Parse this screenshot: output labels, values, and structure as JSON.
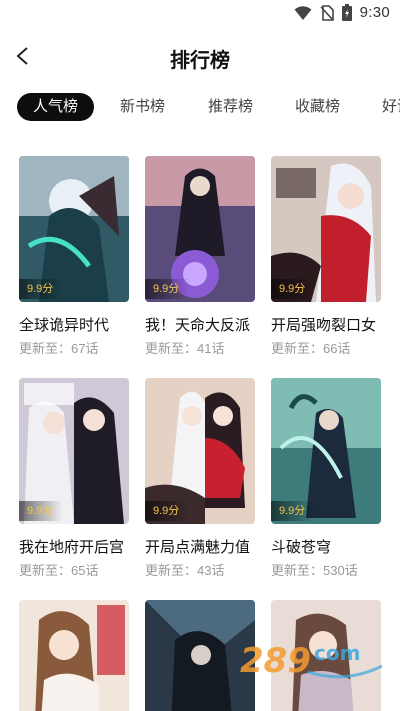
{
  "status": {
    "time": "9:30"
  },
  "header": {
    "title": "排行榜"
  },
  "tabs": [
    {
      "label": "人气榜",
      "active": true
    },
    {
      "label": "新书榜",
      "active": false
    },
    {
      "label": "推荐榜",
      "active": false
    },
    {
      "label": "收藏榜",
      "active": false
    },
    {
      "label": "好评",
      "active": false
    }
  ],
  "items": [
    {
      "name": "全球诡异时代",
      "score": "9.9分",
      "update": "更新至：67话"
    },
    {
      "name": "我！天命大反派",
      "score": "9.9分",
      "update": "更新至：41话"
    },
    {
      "name": "开局强吻裂口女",
      "score": "9.9分",
      "update": "更新至：66话"
    },
    {
      "name": "我在地府开后宫",
      "score": "9.9分",
      "update": "更新至：65话"
    },
    {
      "name": "开局点满魅力值",
      "score": "9.9分",
      "update": "更新至：43话"
    },
    {
      "name": "斗破苍穹",
      "score": "9.9分",
      "update": "更新至：530话"
    },
    {
      "name": "",
      "score": "",
      "update": ""
    },
    {
      "name": "",
      "score": "",
      "update": ""
    },
    {
      "name": "",
      "score": "",
      "update": ""
    }
  ],
  "watermark": {
    "text": "289",
    "sub": "com"
  },
  "colors": {
    "accent": "#0d0d0d",
    "score": "#f3c44b",
    "subtext": "#999999"
  },
  "icons": [
    "wifi-icon",
    "no-sim-icon",
    "battery-icon",
    "back-arrow-icon"
  ]
}
